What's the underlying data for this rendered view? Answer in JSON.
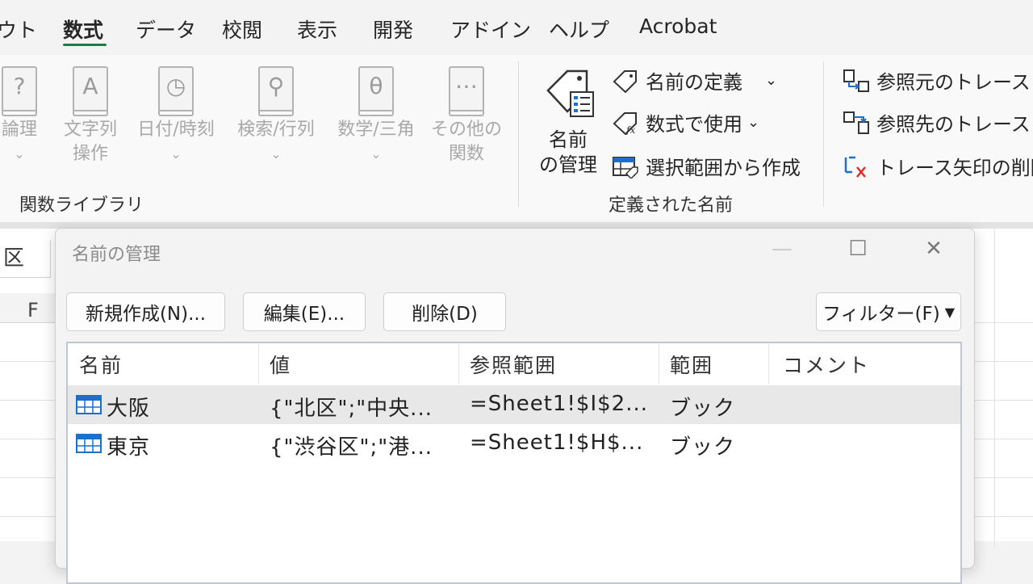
{
  "menu": {
    "tabs": [
      "ウト",
      "数式",
      "データ",
      "校閲",
      "表示",
      "開発",
      "アドイン",
      "ヘルプ",
      "Acrobat"
    ],
    "active_tab": "数式"
  },
  "ribbon": {
    "function_library": {
      "buttons": [
        {
          "label": "論理",
          "icon": "question-book-icon",
          "glyph": "?"
        },
        {
          "label": "文字列\n操作",
          "icon": "text-book-icon",
          "glyph": "A"
        },
        {
          "label": "日付/時刻",
          "icon": "clock-book-icon",
          "glyph": "◷"
        },
        {
          "label": "検索/行列",
          "icon": "search-book-icon",
          "glyph": "⚲"
        },
        {
          "label": "数学/三角",
          "icon": "theta-book-icon",
          "glyph": "θ"
        },
        {
          "label": "その他の\n関数",
          "icon": "more-book-icon",
          "glyph": "⋯"
        }
      ],
      "group_label": "関数ライブラリ"
    },
    "defined_names": {
      "name_manager": {
        "line1": "名前",
        "line2": "の管理"
      },
      "define_name": "名前の定義",
      "use_in_formula": "数式で使用",
      "create_from_selection": "選択範囲から作成",
      "group_label": "定義された名前"
    },
    "formula_auditing": {
      "trace_precedents": "参照元のトレース",
      "trace_dependents": "参照先のトレース",
      "remove_arrows": "トレース矢印の削除"
    }
  },
  "sheet": {
    "name_box": "区",
    "column_letter": "F"
  },
  "dialog": {
    "title": "名前の管理",
    "minimize": "—",
    "maximize": "☐",
    "close": "✕",
    "buttons": {
      "new": "新規作成(N)...",
      "edit": "編集(E)...",
      "delete": "削除(D)",
      "filter": "フィルター(F)"
    },
    "columns": [
      "名前",
      "値",
      "参照範囲",
      "範囲",
      "コメント"
    ],
    "rows": [
      {
        "name": "大阪",
        "value": "{\"北区\";\"中央...",
        "refers_to": "=Sheet1!$I$2...",
        "scope": "ブック",
        "comment": ""
      },
      {
        "name": "東京",
        "value": "{\"渋谷区\";\"港...",
        "refers_to": "=Sheet1!$H$...",
        "scope": "ブック",
        "comment": ""
      }
    ]
  },
  "colors": {
    "accent_green": "#1f7a45",
    "table_icon_blue": "#1e6fc7"
  }
}
